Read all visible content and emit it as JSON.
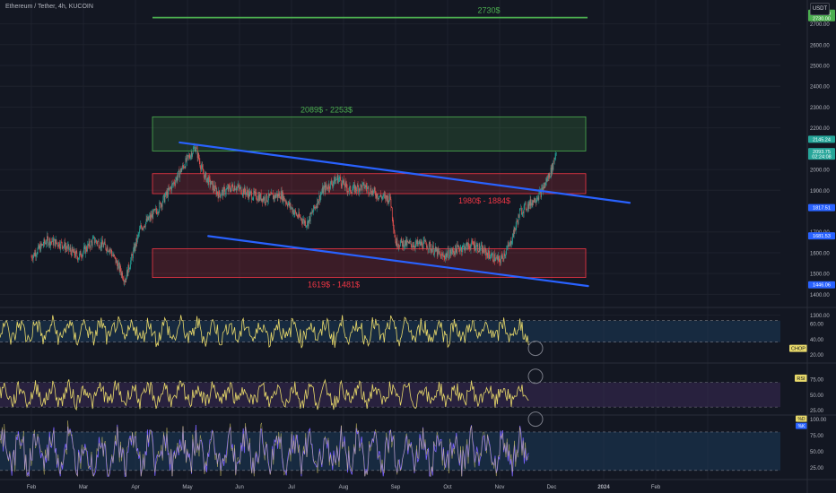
{
  "header": {
    "symbol_title": "Ethereum / Tether, 4h, KUCOIN",
    "currency_button": "USDT"
  },
  "colors": {
    "background": "#131722",
    "grid": "#1e222d",
    "axis_text": "#b2b5be",
    "candle_up": "#26a69a",
    "candle_down": "#ef5350",
    "trendline": "#2962ff",
    "zone_green": "#4caf50",
    "zone_red": "#f23645",
    "oscillator_line": "#e8d96a",
    "stoch_k": "#7b61ff",
    "stoch_d": "#e8d96a"
  },
  "chart_data": {
    "type": "candlestick",
    "price_axis": {
      "ylim": [
        1350,
        2780
      ],
      "ticks": [
        "2700.00",
        "2600.00",
        "2500.00",
        "2400.00",
        "2300.00",
        "2200.00",
        "2000.00",
        "1900.00",
        "1700.00",
        "1600.00",
        "1500.00",
        "1400.00",
        "1300.00"
      ]
    },
    "time_axis": {
      "labels": [
        "Feb",
        "Mar",
        "Apr",
        "May",
        "Jun",
        "Jul",
        "Aug",
        "Sep",
        "Oct",
        "Nov",
        "Dec",
        "2024",
        "Feb"
      ]
    },
    "price_path": [
      {
        "t": 0,
        "p": 1580
      },
      {
        "t": 0.3,
        "p": 1660
      },
      {
        "t": 0.6,
        "p": 1640
      },
      {
        "t": 0.9,
        "p": 1580
      },
      {
        "t": 1.2,
        "p": 1660
      },
      {
        "t": 1.5,
        "p": 1620
      },
      {
        "t": 1.8,
        "p": 1470
      },
      {
        "t": 2.1,
        "p": 1720
      },
      {
        "t": 2.4,
        "p": 1800
      },
      {
        "t": 2.7,
        "p": 1920
      },
      {
        "t": 3.0,
        "p": 2050
      },
      {
        "t": 3.15,
        "p": 2110
      },
      {
        "t": 3.3,
        "p": 1980
      },
      {
        "t": 3.6,
        "p": 1880
      },
      {
        "t": 3.9,
        "p": 1920
      },
      {
        "t": 4.2,
        "p": 1880
      },
      {
        "t": 4.5,
        "p": 1860
      },
      {
        "t": 4.8,
        "p": 1880
      },
      {
        "t": 5.1,
        "p": 1780
      },
      {
        "t": 5.3,
        "p": 1740
      },
      {
        "t": 5.6,
        "p": 1900
      },
      {
        "t": 5.9,
        "p": 1960
      },
      {
        "t": 6.1,
        "p": 1900
      },
      {
        "t": 6.4,
        "p": 1920
      },
      {
        "t": 6.7,
        "p": 1870
      },
      {
        "t": 6.9,
        "p": 1860
      },
      {
        "t": 7.0,
        "p": 1650
      },
      {
        "t": 7.3,
        "p": 1640
      },
      {
        "t": 7.6,
        "p": 1640
      },
      {
        "t": 7.9,
        "p": 1580
      },
      {
        "t": 8.2,
        "p": 1620
      },
      {
        "t": 8.5,
        "p": 1640
      },
      {
        "t": 8.8,
        "p": 1590
      },
      {
        "t": 9.0,
        "p": 1560
      },
      {
        "t": 9.2,
        "p": 1640
      },
      {
        "t": 9.4,
        "p": 1800
      },
      {
        "t": 9.6,
        "p": 1840
      },
      {
        "t": 9.8,
        "p": 1890
      },
      {
        "t": 10.0,
        "p": 2000
      },
      {
        "t": 10.1,
        "p": 2100
      }
    ],
    "zones": [
      {
        "type": "resistance",
        "color": "green",
        "top": 2253,
        "bottom": 2089,
        "label": "2089$ - 2253$"
      },
      {
        "type": "resistance",
        "color": "red",
        "top": 1980,
        "bottom": 1884,
        "label": "1980$ - 1884$"
      },
      {
        "type": "support",
        "color": "red",
        "top": 1619,
        "bottom": 1481,
        "label": "1619$ - 1481$"
      }
    ],
    "target_line": {
      "price": 2730,
      "label": "2730$"
    },
    "trendlines": [
      {
        "from": {
          "t": 2.85,
          "p": 2130
        },
        "to": {
          "t": 11.5,
          "p": 1840
        }
      },
      {
        "from": {
          "t": 3.4,
          "p": 1680
        },
        "to": {
          "t": 10.7,
          "p": 1440
        }
      }
    ],
    "price_badges": [
      {
        "value": "2740.00",
        "line2": "2730.00",
        "color": "#4caf50",
        "price": 2740
      },
      {
        "value": "2145.24",
        "color": "#26a69a",
        "price": 2145
      },
      {
        "value": "2093.75",
        "line2": "02:24:08",
        "color": "#26a69a",
        "price": 2075
      },
      {
        "value": "1817.51",
        "color": "#2962ff",
        "price": 1817
      },
      {
        "value": "1681.53",
        "color": "#2962ff",
        "price": 1681
      },
      {
        "value": "1446.06",
        "color": "#2962ff",
        "price": 1446
      }
    ],
    "panes": [
      {
        "name": "CHOP",
        "ticks": [
          "60.00",
          "40.00",
          "20.00"
        ],
        "label": "CHOP"
      },
      {
        "name": "RSI",
        "ticks": [
          "75.00",
          "50.00",
          "25.00"
        ],
        "label": "RSI"
      },
      {
        "name": "Stoch",
        "ticks": [
          "100.00",
          "75.00",
          "50.00",
          "25.00"
        ],
        "label_k": "%K",
        "label_d": "%D"
      }
    ]
  }
}
